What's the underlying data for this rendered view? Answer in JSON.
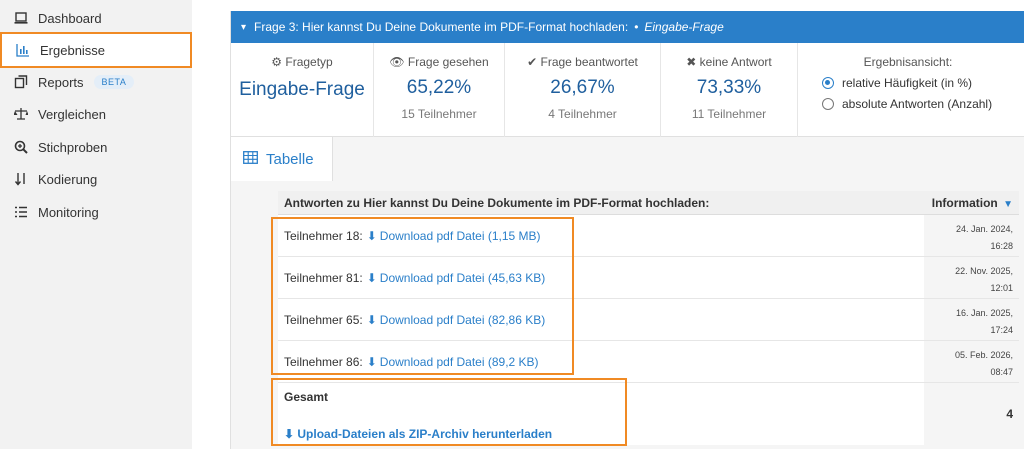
{
  "sidebar": {
    "items": [
      {
        "label": "Dashboard",
        "icon": "laptop-icon"
      },
      {
        "label": "Ergebnisse",
        "icon": "bar-chart-icon",
        "active": true
      },
      {
        "label": "Reports",
        "icon": "copy-icon",
        "badge": "BETA"
      },
      {
        "label": "Vergleichen",
        "icon": "scale-icon"
      },
      {
        "label": "Stichproben",
        "icon": "search-plus-icon"
      },
      {
        "label": "Kodierung",
        "icon": "sort-icon"
      },
      {
        "label": "Monitoring",
        "icon": "list-icon"
      }
    ]
  },
  "question": {
    "title": "Frage 3: Hier kannst Du Deine Dokumente im PDF-Format hochladen:",
    "separator": "•",
    "type_label": "Eingabe-Frage"
  },
  "stats": {
    "fragetyp": {
      "label": "Fragetyp",
      "value": "Eingabe-Frage"
    },
    "gesehen": {
      "label": "Frage gesehen",
      "value": "65,22%",
      "sub": "15 Teilnehmer"
    },
    "beantwortet": {
      "label": "Frage beantwortet",
      "value": "26,67%",
      "sub": "4 Teilnehmer"
    },
    "keine": {
      "label": "keine Antwort",
      "value": "73,33%",
      "sub": "11 Teilnehmer"
    },
    "ansicht": {
      "label": "Ergebnisansicht:",
      "options": [
        {
          "label": "relative Häufigkeit (in %)",
          "selected": true
        },
        {
          "label": "absolute Antworten (Anzahl)",
          "selected": false
        }
      ]
    }
  },
  "tab": {
    "label": "Tabelle"
  },
  "table": {
    "header": "Antworten zu Hier kannst Du Deine Dokumente im PDF-Format hochladen:",
    "info_header": "Information",
    "rows": [
      {
        "participant": "Teilnehmer 18:",
        "link": "Download pdf Datei (1,15 MB)",
        "date": "24. Jan. 2024,",
        "time": "16:28"
      },
      {
        "participant": "Teilnehmer 81:",
        "link": "Download pdf Datei (45,63 KB)",
        "date": "22. Nov. 2025,",
        "time": "12:01"
      },
      {
        "participant": "Teilnehmer 65:",
        "link": "Download pdf Datei (82,86 KB)",
        "date": "16. Jan. 2025,",
        "time": "17:24"
      },
      {
        "participant": "Teilnehmer 86:",
        "link": "Download pdf Datei (89,2 KB)",
        "date": "05. Feb. 2026,",
        "time": "08:47"
      }
    ],
    "total": {
      "label": "Gesamt",
      "count": "4",
      "zip_link": "Upload-Dateien als ZIP-Archiv herunterladen"
    }
  },
  "colors": {
    "accent": "#2a7fc9",
    "highlight": "#f08a24",
    "header_bg": "#2a7fc9"
  }
}
